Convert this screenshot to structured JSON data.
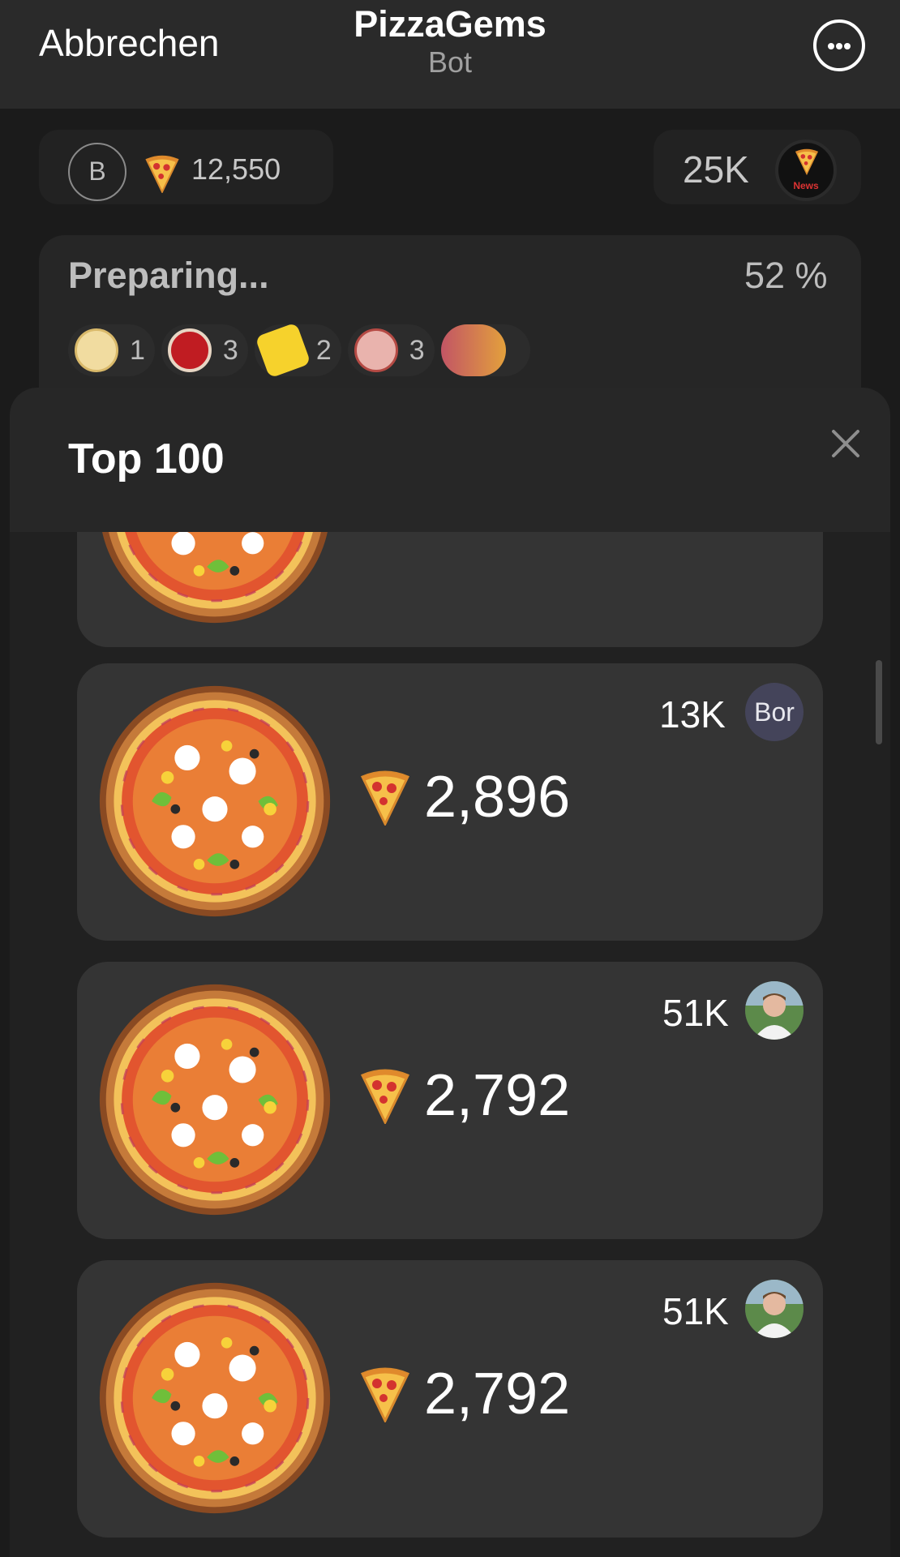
{
  "topbar": {
    "cancel_label": "Abbrechen",
    "title": "PizzaGems",
    "subtitle": "Bot",
    "more_icon": "more-horizontal-icon"
  },
  "status_bar": {
    "user_initial": "B",
    "score": "12,550",
    "community_count": "25K",
    "community_avatar_label": "News"
  },
  "preparing": {
    "title": "Preparing...",
    "percent": "52 %",
    "progress": 0.52,
    "ingredients": [
      {
        "icon": "dough-icon",
        "count": "1"
      },
      {
        "icon": "tomato-sauce-icon",
        "count": "3"
      },
      {
        "icon": "cheese-icon",
        "count": "2"
      },
      {
        "icon": "ham-icon",
        "count": "3"
      }
    ]
  },
  "sheet": {
    "title": "Top 100",
    "close_icon": "close-icon"
  },
  "entries": [
    {
      "score": "2,896",
      "count": "13K",
      "avatar_text": "Bor"
    },
    {
      "score": "2,792",
      "count": "51K",
      "avatar_text": ""
    },
    {
      "score": "2,792",
      "count": "51K",
      "avatar_text": ""
    }
  ],
  "colors": {
    "background": "#1b1b1b",
    "card": "#343434",
    "sheet": "#212121",
    "accent_gradient_start": "#c25565",
    "accent_gradient_end": "#e3a03c"
  }
}
